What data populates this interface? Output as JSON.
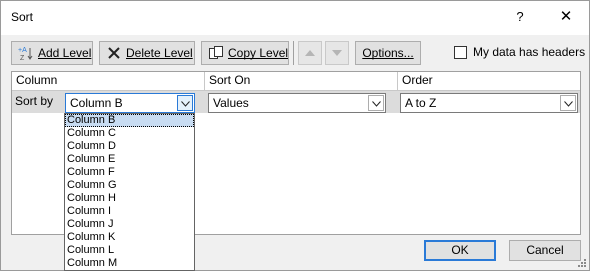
{
  "window": {
    "title": "Sort",
    "help_glyph": "?",
    "close_glyph": "✕"
  },
  "toolbar": {
    "add_level": "Add Level",
    "delete_level": "Delete Level",
    "copy_level": "Copy Level",
    "options": "Options...",
    "move_up_icon": "triangle-up-icon",
    "move_down_icon": "triangle-down-icon",
    "my_data_has_headers": "My data has headers",
    "headers_checked": false
  },
  "grid": {
    "headers": {
      "column": "Column",
      "sort_on": "Sort On",
      "order": "Order"
    },
    "row": {
      "label": "Sort by",
      "column_value": "Column B",
      "sort_on_value": "Values",
      "order_value": "A to Z"
    }
  },
  "dropdown": {
    "selected_index": 0,
    "options": [
      "Column B",
      "Column C",
      "Column D",
      "Column E",
      "Column F",
      "Column G",
      "Column H",
      "Column I",
      "Column J",
      "Column K",
      "Column L",
      "Column M"
    ]
  },
  "footer": {
    "ok": "OK",
    "cancel": "Cancel"
  },
  "colors": {
    "accent": "#2a7ad7",
    "selection": "#c8dcf2",
    "dialog_bg": "#f0f0f0"
  }
}
